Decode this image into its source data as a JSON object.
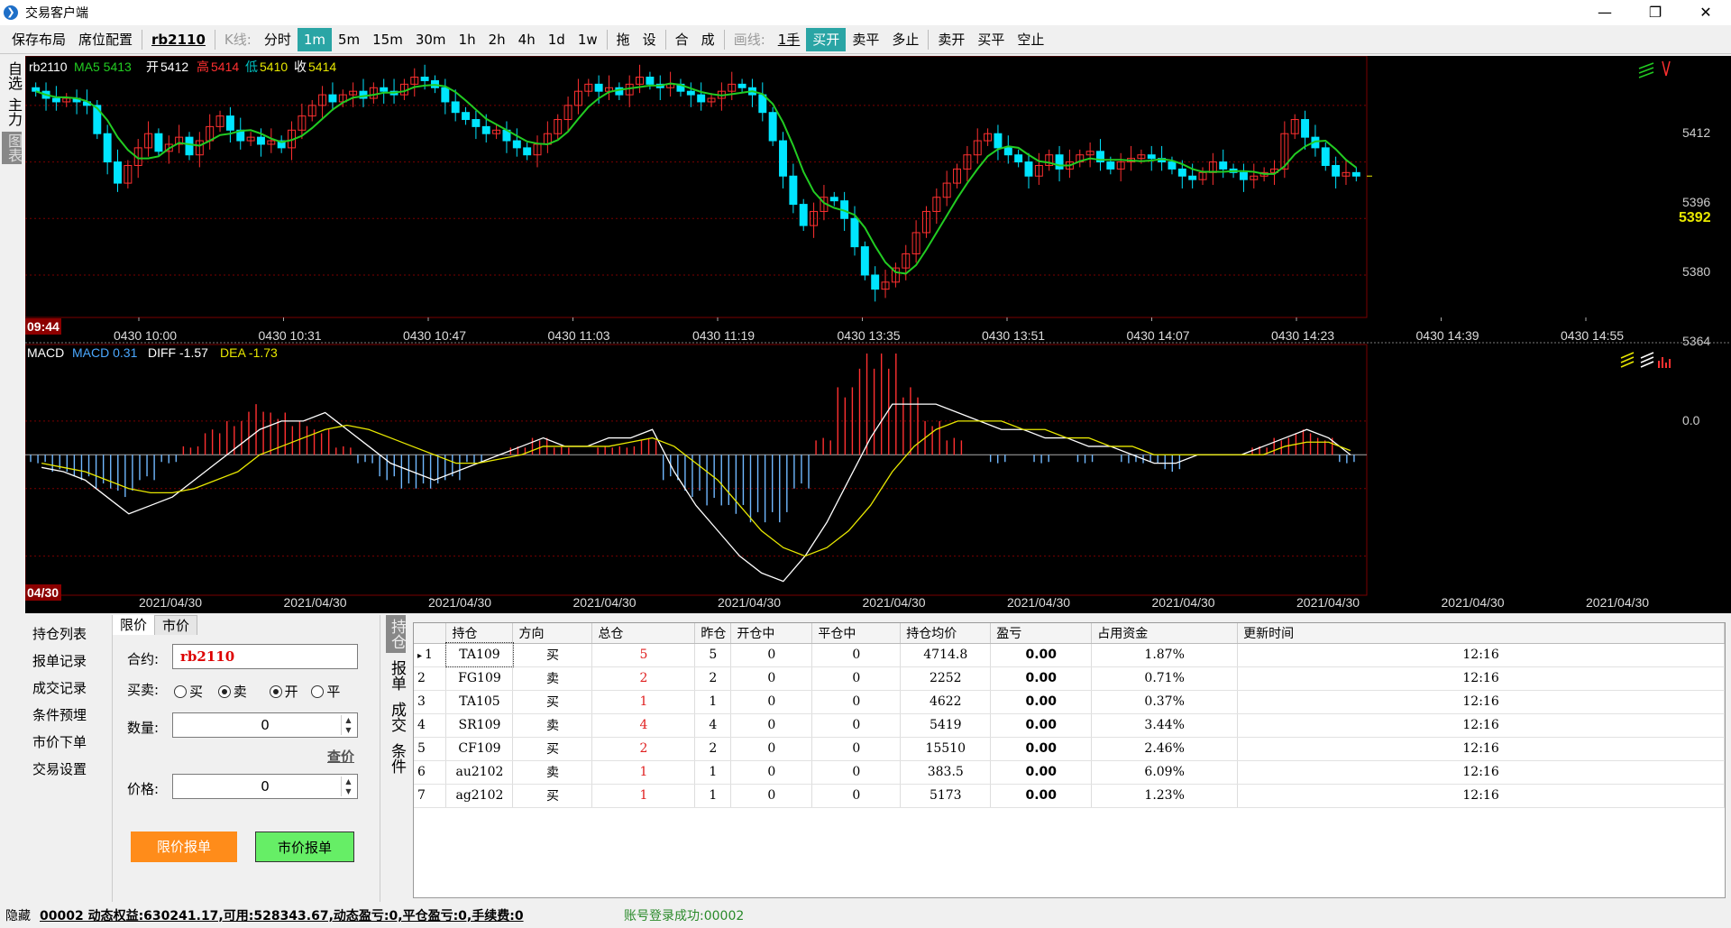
{
  "window": {
    "title": "交易客户端",
    "min": "—",
    "max": "❐",
    "close": "✕"
  },
  "toolbar": {
    "save_layout": "保存布局",
    "position_config": "席位配置",
    "contract": "rb2110",
    "kline_label": "K线:",
    "periods": [
      "分时",
      "1m",
      "5m",
      "15m",
      "30m",
      "1h",
      "2h",
      "4h",
      "1d",
      "1w"
    ],
    "active_period": "1m",
    "tools": [
      "拖",
      "设",
      "合",
      "成"
    ],
    "draw_label": "画线:",
    "qty": "1手",
    "actions1": [
      "买开",
      "卖平",
      "多止"
    ],
    "actions2": [
      "卖开",
      "买平",
      "空止"
    ]
  },
  "leftstrip": [
    "自选",
    "主力",
    "图表"
  ],
  "chart": {
    "header": {
      "symbol": "rb2110",
      "ma": "MA5 5413",
      "open_l": "开",
      "open": "5412",
      "high_l": "高",
      "high": "5414",
      "low_l": "低",
      "low": "5410",
      "close_l": "收",
      "close": "5414"
    },
    "price_ticks": [
      "5412",
      "5396",
      "5380",
      "5364"
    ],
    "last_price": "5392",
    "start_time": "09:44",
    "time_ticks": [
      "0430 10:00",
      "0430 10:31",
      "0430 10:47",
      "0430 11:03",
      "0430 11:19",
      "0430 13:35",
      "0430 13:51",
      "0430 14:07",
      "0430 14:23",
      "0430 14:39",
      "0430 14:55"
    ],
    "macd_header": {
      "name": "MACD",
      "macd": "MACD 0.31",
      "diff": "DIFF -1.57",
      "dea": "DEA -1.73"
    },
    "macd_zero": "0.0",
    "macd_start": "04/30",
    "date_ticks": [
      "2021/04/30",
      "2021/04/30",
      "2021/04/30",
      "2021/04/30",
      "2021/04/30",
      "2021/04/30",
      "2021/04/30",
      "2021/04/30",
      "2021/04/30",
      "2021/04/30",
      "2021/04/30"
    ],
    "colors": {
      "up": "#ff3030",
      "down": "#00e5ff",
      "ma": "#22cc22",
      "diff": "#ffffff",
      "dea": "#e8e800",
      "grid": "#7a0000"
    }
  },
  "chart_data": {
    "type": "candlestick",
    "ylim": [
      5352,
      5426
    ],
    "macd_ylim": [
      -16,
      12
    ],
    "closes": [
      5416,
      5414,
      5413,
      5414,
      5413,
      5412,
      5404,
      5396,
      5390,
      5395,
      5400,
      5404,
      5399,
      5401,
      5403,
      5398,
      5402,
      5406,
      5409,
      5405,
      5402,
      5403,
      5401,
      5402,
      5400,
      5405,
      5409,
      5412,
      5415,
      5413,
      5415,
      5416,
      5414,
      5417,
      5416,
      5415,
      5418,
      5420,
      5419,
      5417,
      5413,
      5410,
      5408,
      5406,
      5404,
      5405,
      5402,
      5400,
      5398,
      5401,
      5404,
      5408,
      5412,
      5416,
      5418,
      5416,
      5417,
      5415,
      5418,
      5420,
      5418,
      5417,
      5418,
      5416,
      5415,
      5413,
      5414,
      5416,
      5418,
      5417,
      5415,
      5410,
      5402,
      5392,
      5384,
      5378,
      5382,
      5386,
      5385,
      5380,
      5372,
      5364,
      5360,
      5362,
      5366,
      5370,
      5376,
      5382,
      5386,
      5390,
      5394,
      5398,
      5402,
      5404,
      5400,
      5398,
      5396,
      5392,
      5395,
      5398,
      5394,
      5396,
      5398,
      5399,
      5396,
      5394,
      5396,
      5397,
      5398,
      5397,
      5396,
      5394,
      5392,
      5391,
      5393,
      5396,
      5394,
      5393,
      5391,
      5392,
      5393,
      5394,
      5404,
      5408,
      5403,
      5400,
      5395,
      5392,
      5393,
      5392
    ],
    "macd": {
      "diff": [
        -1.5,
        -2,
        -3,
        -5,
        -7,
        -6,
        -5,
        -3,
        -1,
        1,
        3,
        4,
        4,
        5,
        3,
        1,
        -1,
        -2,
        -3,
        -2,
        -1,
        0,
        1,
        2,
        1,
        1,
        2,
        2,
        3,
        -2,
        -6,
        -9,
        -12,
        -14,
        -15,
        -12,
        -8,
        -3,
        2,
        6,
        6,
        6,
        5,
        4,
        3,
        3,
        2,
        2,
        1,
        1,
        0,
        -1,
        -1,
        0,
        0,
        0,
        1,
        2,
        3,
        2,
        0
      ],
      "dea": [
        -1,
        -1.5,
        -2,
        -3,
        -4,
        -4.5,
        -4.5,
        -4,
        -3,
        -2,
        0,
        1,
        2,
        3,
        3.5,
        3,
        2,
        1,
        0,
        -1,
        -1,
        -0.5,
        0,
        1,
        1,
        1,
        1,
        1.5,
        2,
        1,
        -1,
        -3,
        -6,
        -9,
        -11,
        -12,
        -11,
        -9,
        -6,
        -2,
        1,
        3,
        4,
        4,
        4,
        3,
        3,
        2,
        2,
        1,
        1,
        0,
        0,
        0,
        0,
        0,
        0,
        1,
        1.5,
        1.5,
        0.5
      ],
      "hist": [
        -1,
        -2,
        -3,
        -4,
        -5,
        -3,
        -1,
        1,
        3,
        4,
        6,
        5,
        4,
        3,
        1,
        -1,
        -3,
        -4,
        -4,
        -3,
        -1,
        0,
        1,
        2,
        1,
        0,
        1,
        1,
        2,
        -3,
        -5,
        -6,
        -7,
        -8,
        -8,
        -4,
        2,
        8,
        12,
        12,
        8,
        4,
        2,
        0,
        -1,
        0,
        -1,
        0,
        -1,
        0,
        -1,
        -1,
        -2,
        0,
        0,
        0,
        1,
        2,
        3,
        2,
        -1
      ]
    }
  },
  "leftmenu": [
    "持仓列表",
    "报单记录",
    "成交记录",
    "条件预埋",
    "市价下单",
    "交易设置"
  ],
  "order": {
    "tab_limit": "限价",
    "tab_market": "市价",
    "contract_label": "合约:",
    "contract_value": "rb2110",
    "side_label": "买卖:",
    "buy": "买",
    "sell": "卖",
    "open": "开",
    "close": "平",
    "qty_label": "数量:",
    "qty_value": "0",
    "query_price": "查价",
    "price_label": "价格:",
    "price_value": "0",
    "limit_btn": "限价报单",
    "market_btn": "市价报单",
    "limit_btn_color": "#ff8c1a",
    "market_btn_color": "#66ee66"
  },
  "sidetabs": [
    "持仓",
    "报单",
    "成交",
    "条件"
  ],
  "positions": {
    "headers": [
      "持仓",
      "方向",
      "总仓",
      "昨仓",
      "开仓中",
      "平仓中",
      "持仓均价",
      "盈亏",
      "占用资金",
      "更新时间"
    ],
    "rows": [
      [
        "1",
        "TA109",
        "买",
        "5",
        "5",
        "0",
        "0",
        "4714.8",
        "0.00",
        "1.87%",
        "12:16"
      ],
      [
        "2",
        "FG109",
        "卖",
        "2",
        "2",
        "0",
        "0",
        "2252",
        "0.00",
        "0.71%",
        "12:16"
      ],
      [
        "3",
        "TA105",
        "买",
        "1",
        "1",
        "0",
        "0",
        "4622",
        "0.00",
        "0.37%",
        "12:16"
      ],
      [
        "4",
        "SR109",
        "卖",
        "4",
        "4",
        "0",
        "0",
        "5419",
        "0.00",
        "3.44%",
        "12:16"
      ],
      [
        "5",
        "CF109",
        "买",
        "2",
        "2",
        "0",
        "0",
        "15510",
        "0.00",
        "2.46%",
        "12:16"
      ],
      [
        "6",
        "au2102",
        "卖",
        "1",
        "1",
        "0",
        "0",
        "383.5",
        "0.00",
        "6.09%",
        "12:16"
      ],
      [
        "7",
        "ag2102",
        "买",
        "1",
        "1",
        "0",
        "0",
        "5173",
        "0.00",
        "1.23%",
        "12:16"
      ]
    ],
    "selected_marker": "▸"
  },
  "status": {
    "hide": "隐藏",
    "account": "00002 动态权益:630241.17,可用:528343.67,动态盈亏:0,平仓盈亏:0,手续费:0",
    "login": "账号登录成功:00002"
  }
}
